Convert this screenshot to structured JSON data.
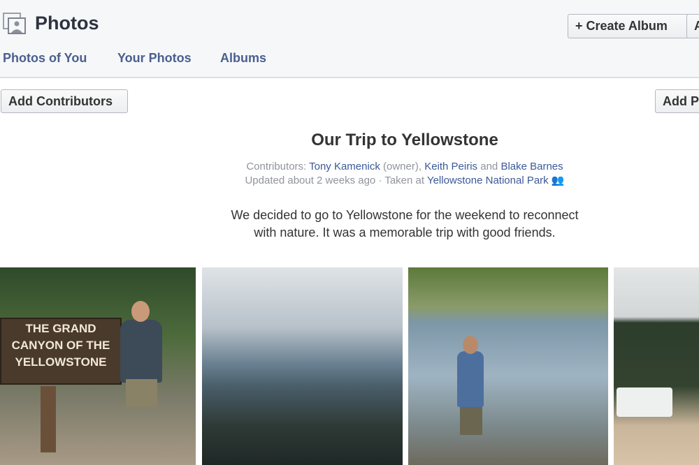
{
  "header": {
    "title": "Photos",
    "create_album_label": "+ Create Album",
    "partial_button_label": "A"
  },
  "tabs": [
    {
      "label": "Photos of You"
    },
    {
      "label": "Your Photos"
    },
    {
      "label": "Albums"
    }
  ],
  "toolbar": {
    "add_contributors_label": "Add Contributors",
    "add_photos_label": "Add P"
  },
  "album": {
    "title": "Our Trip to Yellowstone",
    "contributors_prefix": "Contributors:",
    "contributor_1": "Tony Kamenick",
    "owner_tag": "(owner),",
    "contributor_2": "Keith Peiris",
    "and": "and",
    "contributor_3": "Blake Barnes",
    "updated": "Updated about 2 weeks ago · Taken at",
    "location": "Yellowstone National Park",
    "description_line1": "We decided to go to Yellowstone for the weekend to reconnect",
    "description_line2": "with nature. It was a memorable trip with good friends."
  },
  "photos": [
    {
      "sign_text": "THE GRAND CANYON OF THE YELLOWSTONE"
    },
    {},
    {},
    {}
  ]
}
